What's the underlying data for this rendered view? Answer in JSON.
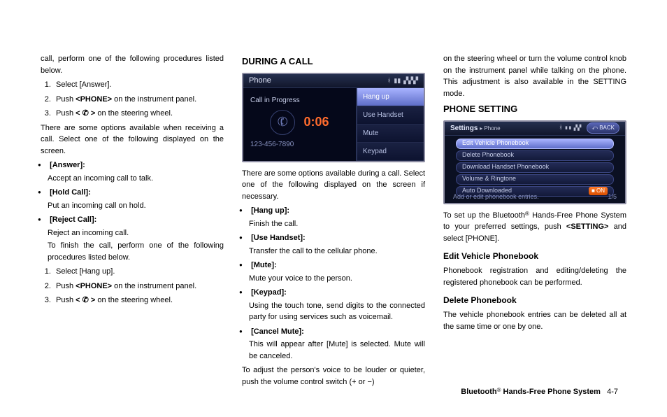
{
  "col1": {
    "intro": "call, perform one of the following procedures listed below.",
    "steps1": [
      "Select [Answer].",
      "Push <PHONE> on the instrument panel.",
      "Push <   ✆  > on the steering wheel."
    ],
    "receive": "There are some options available when receiving a call. Select one of the following displayed on the screen.",
    "options": [
      {
        "label": "[Answer]:",
        "desc": "Accept an incoming call to talk."
      },
      {
        "label": "[Hold Call]:",
        "desc": "Put an incoming call on hold."
      },
      {
        "label": "[Reject Call]:",
        "desc": "Reject an incoming call."
      }
    ],
    "finish_lead": "To finish the call, perform one of the following procedures listed below.",
    "steps2": [
      "Select [Hang up].",
      "Push <PHONE> on the instrument panel.",
      "Push <   ✆  > on the steering wheel."
    ]
  },
  "col2": {
    "heading": "DURING A CALL",
    "phone_title": "Phone",
    "cip": "Call in Progress",
    "timer": "0:06",
    "number": "123-456-7890",
    "menu": [
      "Hang up",
      "Use Handset",
      "Mute",
      "Keypad"
    ],
    "lead": "There are some options available during a call. Select one of the following displayed on the screen if necessary.",
    "options": [
      {
        "label": "[Hang up]:",
        "desc": "Finish the call."
      },
      {
        "label": "[Use Handset]:",
        "desc": "Transfer the call to the cellular phone."
      },
      {
        "label": "[Mute]:",
        "desc": "Mute your voice to the person."
      },
      {
        "label": "[Keypad]:",
        "desc": "Using the touch tone, send digits to the connected party for using services such as voicemail."
      },
      {
        "label": "[Cancel Mute]:",
        "desc": "This will appear after [Mute] is selected. Mute will be canceled."
      }
    ],
    "adjust": "To adjust the person's voice to be louder or quieter, push the volume control switch (+ or −)"
  },
  "col3": {
    "intro": "on the steering wheel or turn the volume control knob on the instrument panel while talking on the phone. This adjustment is also available in the SETTING mode.",
    "heading": "PHONE SETTING",
    "settings_title_a": "Settings",
    "settings_title_b": "▸ Phone",
    "back": "⤺ BACK",
    "rows": [
      "Edit Vehicle Phonebook",
      "Delete Phonebook",
      "Download Handset Phonebook",
      "Volume & Ringtone",
      "Auto Downloaded"
    ],
    "on": "■ ON",
    "status_left": "Add or edit phonebook entries.",
    "status_right": "1/5",
    "setup_a": "To set up the Bluetooth",
    "setup_b": " Hands-Free Phone System to your preferred settings, push ",
    "setup_c": "<SETTING>",
    "setup_d": " and select [PHONE].",
    "h_edit": "Edit Vehicle Phonebook",
    "p_edit": "Phonebook registration and editing/deleting the registered phonebook can be performed.",
    "h_delete": "Delete Phonebook",
    "p_delete": "The vehicle phonebook entries can be deleted all at the same time or one by one."
  },
  "footer": {
    "chapter": "Bluetooth",
    "suffix": " Hands-Free Phone System",
    "page": "4-7"
  }
}
